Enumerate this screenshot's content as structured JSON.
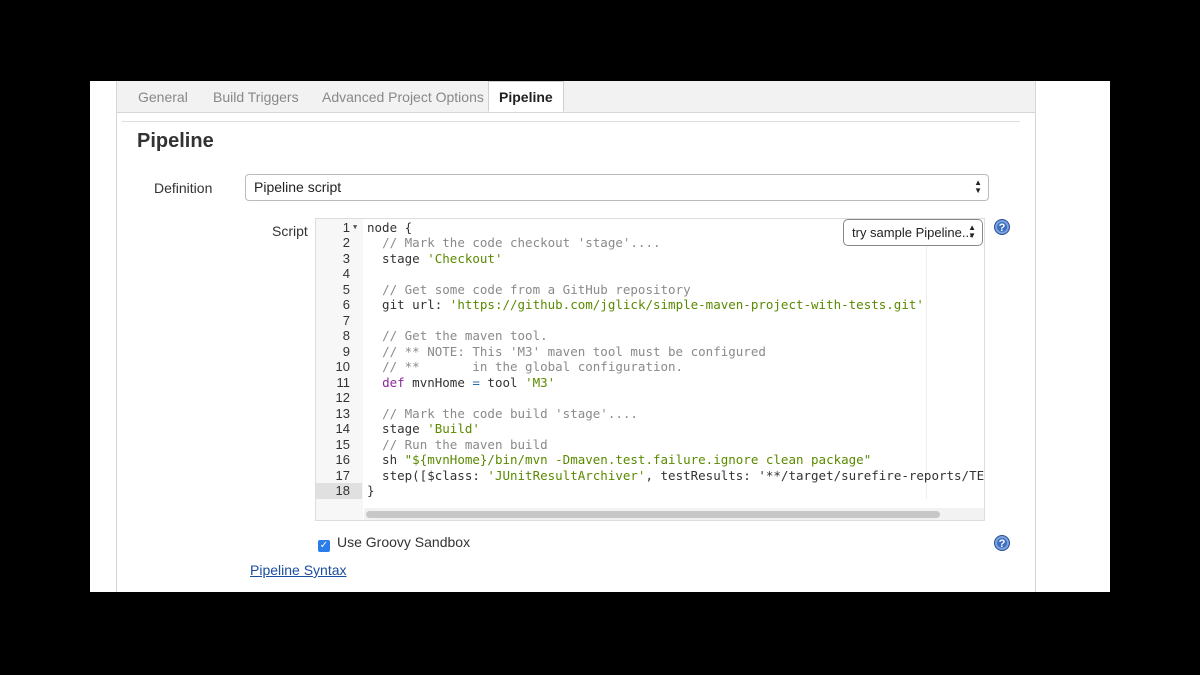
{
  "tabs": [
    {
      "label": "General"
    },
    {
      "label": "Build Triggers"
    },
    {
      "label": "Advanced Project Options"
    },
    {
      "label": "Pipeline",
      "active": true
    }
  ],
  "section_title": "Pipeline",
  "definition": {
    "label": "Definition",
    "selected": "Pipeline script"
  },
  "script": {
    "label": "Script",
    "sample_button": "try sample Pipeline...",
    "current_line": 18,
    "lines": [
      {
        "n": "1",
        "text": "node {"
      },
      {
        "n": "2",
        "text": "  // Mark the code checkout 'stage'...."
      },
      {
        "n": "3",
        "text": "  stage 'Checkout'"
      },
      {
        "n": "4",
        "text": ""
      },
      {
        "n": "5",
        "text": "  // Get some code from a GitHub repository"
      },
      {
        "n": "6",
        "text": "  git url: 'https://github.com/jglick/simple-maven-project-with-tests.git'"
      },
      {
        "n": "7",
        "text": ""
      },
      {
        "n": "8",
        "text": "  // Get the maven tool."
      },
      {
        "n": "9",
        "text": "  // ** NOTE: This 'M3' maven tool must be configured"
      },
      {
        "n": "10",
        "text": "  // **       in the global configuration."
      },
      {
        "n": "11",
        "text": "  def mvnHome = tool 'M3'"
      },
      {
        "n": "12",
        "text": ""
      },
      {
        "n": "13",
        "text": "  // Mark the code build 'stage'...."
      },
      {
        "n": "14",
        "text": "  stage 'Build'"
      },
      {
        "n": "15",
        "text": "  // Run the maven build"
      },
      {
        "n": "16",
        "text": "  sh \"${mvnHome}/bin/mvn -Dmaven.test.failure.ignore clean package\""
      },
      {
        "n": "17",
        "text": "  step([$class: 'JUnitResultArchiver', testResults: '**/target/surefire-reports/TEST-*.x"
      },
      {
        "n": "18",
        "text": "}"
      }
    ]
  },
  "sandbox": {
    "label": "Use Groovy Sandbox",
    "checked": true
  },
  "syntax_link": "Pipeline Syntax",
  "help_icon": "?",
  "colors": {
    "comment": "#8a8a8a",
    "string": "#5a8a00",
    "keyword": "#8a2a9a",
    "checkbox": "#2b7de9",
    "link": "#1a4ea0"
  }
}
